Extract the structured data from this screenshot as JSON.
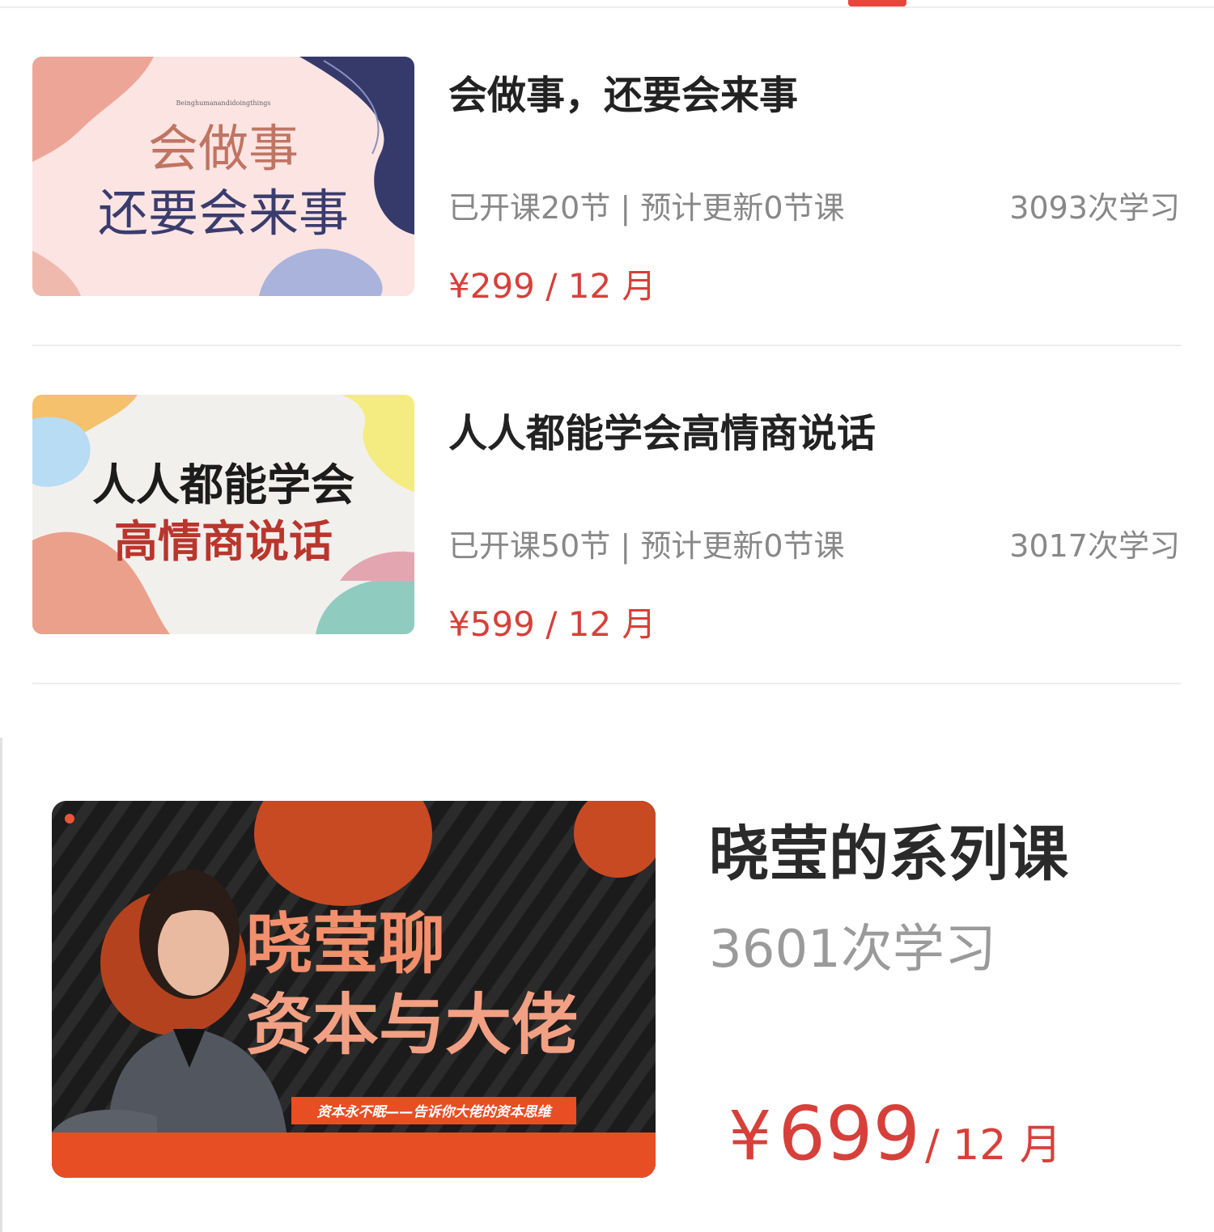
{
  "courses": [
    {
      "title": "会做事，还要会来事",
      "meta": "已开课20节 | 预计更新0节课",
      "count": "3093次学习",
      "price": "¥299 / 12 月",
      "thumb": {
        "line1": "会做事",
        "line2": "还要会来事",
        "small": "Beinghumanandidoingthings"
      }
    },
    {
      "title": "人人都能学会高情商说话",
      "meta": "已开课50节 | 预计更新0节课",
      "count": "3017次学习",
      "price": "¥599 / 12 月",
      "thumb": {
        "line1": "人人都能学会",
        "line2": "高情商说话"
      }
    }
  ],
  "series": {
    "title": "晓莹的系列课",
    "count": "3601次学习",
    "price_currency": "¥",
    "price_value": "699",
    "price_period": "/ 12 月",
    "thumb": {
      "line1": "晓莹聊",
      "line2": "资本与大佬",
      "tagline": "资本永不眠——告诉你大佬的资本思维"
    }
  },
  "colors": {
    "accent": "#d7403a",
    "title": "#222222",
    "meta": "#888888"
  }
}
